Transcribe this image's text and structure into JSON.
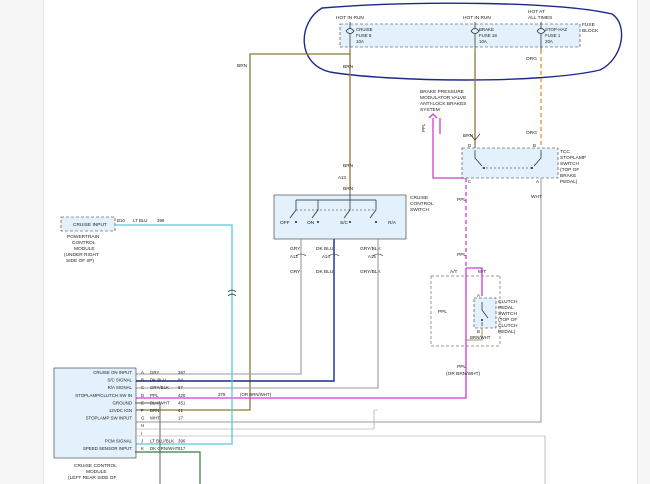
{
  "fuse_block": {
    "hot_in_run_1": "HOT IN RUN",
    "hot_in_run_2": "HOT IN RUN",
    "hot_at_all_times": "HOT AT",
    "hot_at_all_times_2": "ALL TIMES",
    "title_1": "FUSE",
    "title_2": "BLOCK",
    "fuse_cruise_1": "CRUISE",
    "fuse_cruise_2": "FUSE 8",
    "fuse_cruise_3": "10A",
    "fuse_brake_1": "BRAKE",
    "fuse_brake_2": "FUSE 18",
    "fuse_brake_3": "10A",
    "fuse_stop_1": "STOP-HAZ",
    "fuse_stop_2": "FUSE 1",
    "fuse_stop_3": "20A"
  },
  "wires": {
    "brn_a": "BRN",
    "brn_b": "BRN",
    "brn_c": "BRN",
    "brn_d": "BRN",
    "brn_e": "BRN",
    "org_a": "ORG",
    "org_b": "ORG",
    "ppl_a": "PPL",
    "ppl_b": "PPL",
    "ppl_c": "PPL",
    "ppl_d": "PPL",
    "ppl_e": "PPL",
    "ppl_or": "(OR BRN/WHT)",
    "wht": "WHT",
    "brnwht": "BRN/WHT",
    "gry": "GRY",
    "dkblu": "DK BLU",
    "grybl": "GRY/BLK",
    "gry2": "GRY",
    "dkblu2": "DK BLU",
    "grybl2": "GRY/BLK"
  },
  "brake_module": {
    "l1": "BRAKE PRESSURE",
    "l2": "MODULATOR VALVE",
    "l3": "ANTI-LOCK BRAKES",
    "l4": "SYSTEM"
  },
  "tcc_switch": {
    "l1": "TCC",
    "l2": "STOPLAMP",
    "l3": "SWITCH",
    "l4": "(TOP OF",
    "l5": "BRAKE",
    "l6": "PEDAL)",
    "pin_b": "B",
    "pin_c": "C",
    "pin_a": "A",
    "pin_d": "D"
  },
  "cruise_switch": {
    "l1": "CRUISE",
    "l2": "CONTROL",
    "l3": "SWITCH",
    "off": "OFF",
    "on": "ON",
    "sc": "S/C",
    "ra": "R/A",
    "a13": "A13",
    "a12": "A12",
    "a14": "A14",
    "a15": "A15"
  },
  "clutch_switch": {
    "at": "A/T",
    "mt": "M/T",
    "l1": "CLUTCH",
    "l2": "PEDAL",
    "l3": "SWITCH",
    "l4": "(TOP OF",
    "l5": "CLUTCH",
    "l6": "PEDAL)",
    "pin_a": "A",
    "pin_b": "B"
  },
  "pcm": {
    "label": "CRUISE INPUT",
    "pin": "B10",
    "wire": "LT BLU",
    "circuit": "396",
    "n1": "POWERTRAIN",
    "n2": "CONTROL",
    "n3": "MODULE",
    "n4": "(UNDER RIGHT",
    "n5": "SIDE OF I/P)"
  },
  "ccm": {
    "rows": [
      {
        "label": "CRUISE ON INPUT",
        "pin": "A",
        "wire": "GRY",
        "circuit": "397"
      },
      {
        "label": "S/C SIGNAL",
        "pin": "B",
        "wire": "DK BLU",
        "circuit": "84"
      },
      {
        "label": "R/A SIGNAL",
        "pin": "C",
        "wire": "GRY/BLK",
        "circuit": "87"
      },
      {
        "label": "STOPLAMP/CLUTCH SW IN",
        "pin": "D",
        "wire": "PPL",
        "circuit": "420"
      },
      {
        "label": "GROUND",
        "pin": "E",
        "wire": "BLK/WHT",
        "circuit": "451"
      },
      {
        "label": "12VDC IGN",
        "pin": "F",
        "wire": "BRN",
        "circuit": "41"
      },
      {
        "label": "STOPLAMP SW INPUT",
        "pin": "G",
        "wire": "WHT",
        "circuit": "17"
      },
      {
        "label": "",
        "pin": "H",
        "wire": "",
        "circuit": ""
      },
      {
        "label": "",
        "pin": "I",
        "wire": "",
        "circuit": ""
      },
      {
        "label": "PCM SIGNAL",
        "pin": "J",
        "wire": "LT BLU/BLK",
        "circuit": "396"
      },
      {
        "label": "SPEED SENSOR INPUT",
        "pin": "K",
        "wire": "DK GRN/WHT",
        "circuit": "817"
      }
    ],
    "or_note": "(OR BRN/WHT)",
    "or_circuit": "379",
    "n1": "CRUISE CONTROL",
    "n2": "MODULE",
    "n3": "(LEFT REAR SIDE OF"
  },
  "colors": {
    "brn": "#8a7a3a",
    "org": "#e0902a",
    "ppl": "#d23ad0",
    "cyan": "#5ac8d8",
    "navy": "#1a2a8a",
    "grey": "#9a9a9a",
    "dkgrn": "#3a7a3a",
    "box": "#e2f1fb",
    "ink": "#1c2a8a"
  }
}
